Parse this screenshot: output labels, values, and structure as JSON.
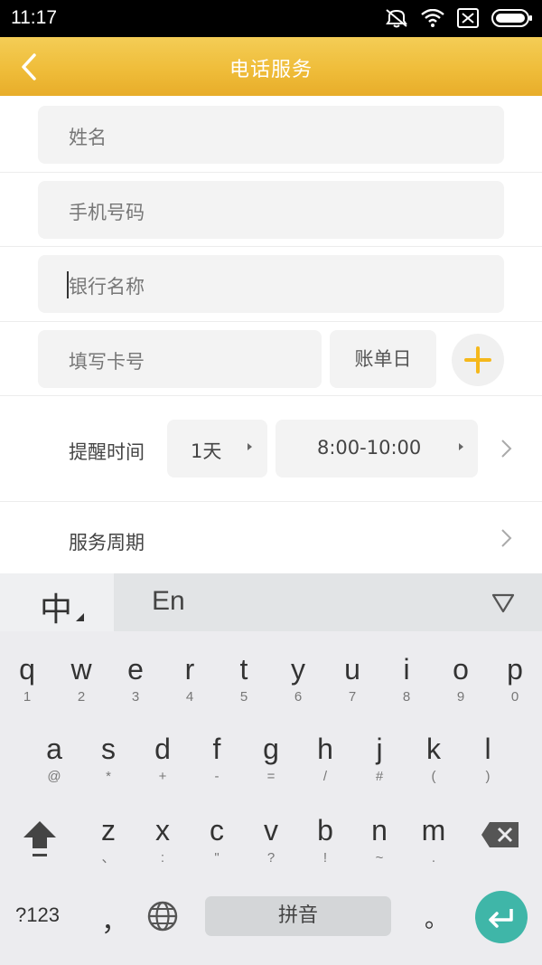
{
  "status_bar": {
    "time": "11:17",
    "icons": [
      "mute-icon",
      "wifi-icon",
      "sim-off-icon",
      "battery-icon"
    ]
  },
  "header": {
    "title": "电话服务",
    "back_icon": "chevron-left-icon",
    "colors": {
      "start": "#f4cd56",
      "end": "#e8ad2a"
    }
  },
  "form": {
    "name_placeholder": "姓名",
    "phone_placeholder": "手机号码",
    "bank_placeholder": "银行名称",
    "card_placeholder": "填写卡号",
    "bill_day_label": "账单日",
    "add_icon": "plus-icon",
    "add_color": "#f5b81c"
  },
  "reminder": {
    "label": "提醒时间",
    "day_value": "1天",
    "time_value": "8:00-10:00"
  },
  "service": {
    "label": "服务周期"
  },
  "keyboard": {
    "lang_cn": "中",
    "lang_en": "En",
    "row1": [
      {
        "k": "q",
        "s": "1"
      },
      {
        "k": "w",
        "s": "2"
      },
      {
        "k": "e",
        "s": "3"
      },
      {
        "k": "r",
        "s": "4"
      },
      {
        "k": "t",
        "s": "5"
      },
      {
        "k": "y",
        "s": "6"
      },
      {
        "k": "u",
        "s": "7"
      },
      {
        "k": "i",
        "s": "8"
      },
      {
        "k": "o",
        "s": "9"
      },
      {
        "k": "p",
        "s": "0"
      }
    ],
    "row2": [
      {
        "k": "a",
        "s": "@"
      },
      {
        "k": "s",
        "s": "*"
      },
      {
        "k": "d",
        "s": "+"
      },
      {
        "k": "f",
        "s": "-"
      },
      {
        "k": "g",
        "s": "="
      },
      {
        "k": "h",
        "s": "/"
      },
      {
        "k": "j",
        "s": "#"
      },
      {
        "k": "k",
        "s": "("
      },
      {
        "k": "l",
        "s": ")"
      }
    ],
    "row3": [
      {
        "k": "z",
        "s": "、"
      },
      {
        "k": "x",
        "s": ":"
      },
      {
        "k": "c",
        "s": "\""
      },
      {
        "k": "v",
        "s": "?"
      },
      {
        "k": "b",
        "s": "!"
      },
      {
        "k": "n",
        "s": "~"
      },
      {
        "k": "m",
        "s": "."
      }
    ],
    "symbols_label": "?123",
    "comma_label": "，",
    "space_label": "拼音",
    "period_label": "。",
    "enter_color": "#3fb6a8"
  }
}
